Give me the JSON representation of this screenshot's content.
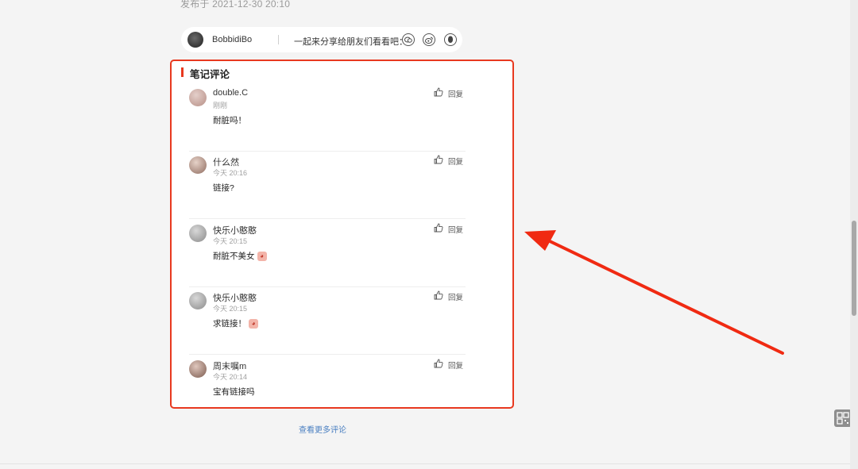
{
  "post": {
    "publish_date": "发布于 2021-12-30 20:10"
  },
  "author": {
    "name": "BobbidiBo",
    "share_text": "一起来分享给朋友们看看吧："
  },
  "comments_section": {
    "title": "笔记评论",
    "like_icon": "thumbs-up-icon",
    "reply_label": "回复",
    "items": [
      {
        "name": "double.C",
        "time": "刚刚",
        "text": "耐脏吗！",
        "avatar_color": "#c9a7a0",
        "has_emoji": false
      },
      {
        "name": "什么然",
        "time": "今天 20:16",
        "text": "链接?",
        "avatar_color": "#a08479",
        "has_emoji": false
      },
      {
        "name": "快乐小憨憨",
        "time": "今天 20:15",
        "text": "耐脏不美女",
        "avatar_color": "#9a9a9a",
        "has_emoji": true
      },
      {
        "name": "快乐小憨憨",
        "time": "今天 20:15",
        "text": "求链接！",
        "avatar_color": "#9a9a9a",
        "has_emoji": true
      },
      {
        "name": "周末嘱m",
        "time": "今天 20:14",
        "text": "宝有链接吗",
        "avatar_color": "#8c6f63",
        "has_emoji": false
      }
    ],
    "more_label": "查看更多评论"
  },
  "colors": {
    "accent_red": "#e8391f",
    "link_blue": "#4a7fc1"
  }
}
